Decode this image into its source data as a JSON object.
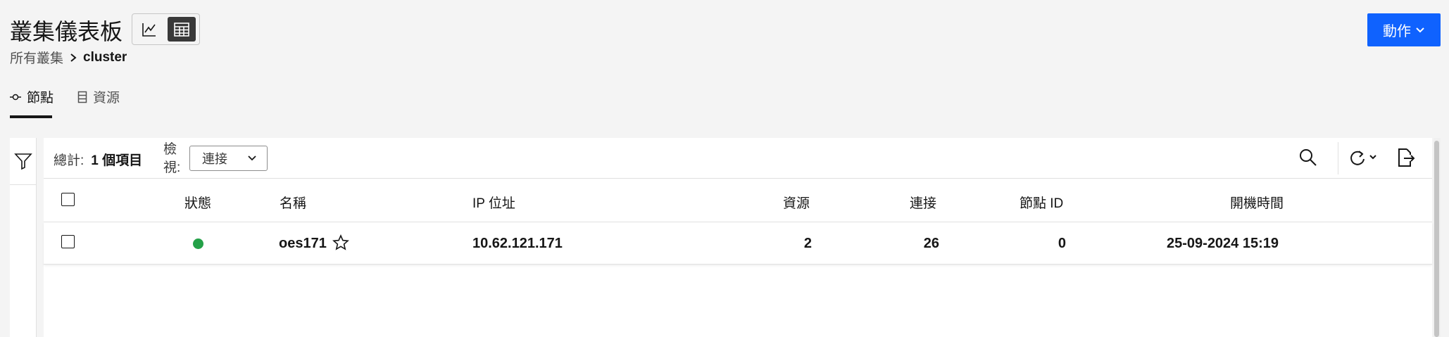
{
  "header": {
    "title": "叢集儀表板",
    "breadcrumb_root": "所有叢集",
    "breadcrumb_current": "cluster",
    "action_label": "動作",
    "view_toggle": {
      "chart_icon": "line-chart-icon",
      "table_icon": "table-icon",
      "selected": "table"
    }
  },
  "tabs": [
    {
      "label": "節點",
      "icon": "node-icon",
      "selected": true
    },
    {
      "label": "資源",
      "icon": "resource-icon",
      "selected": false
    }
  ],
  "toolbar": {
    "total_label": "總計:",
    "total_value": "1 個項目",
    "view_label": "檢視:",
    "view_value": "連接"
  },
  "table": {
    "columns": [
      "狀態",
      "名稱",
      "IP 位址",
      "資源",
      "連接",
      "節點 ID",
      "開機時間"
    ],
    "rows": [
      {
        "status_color": "#24a148",
        "name": "oes171",
        "ip": "10.62.121.171",
        "resources": "2",
        "connections": "26",
        "node_id": "0",
        "boot_time": "25-09-2024 15:19"
      }
    ]
  },
  "colors": {
    "accent": "#0f62fe",
    "status_ok": "#24a148"
  }
}
